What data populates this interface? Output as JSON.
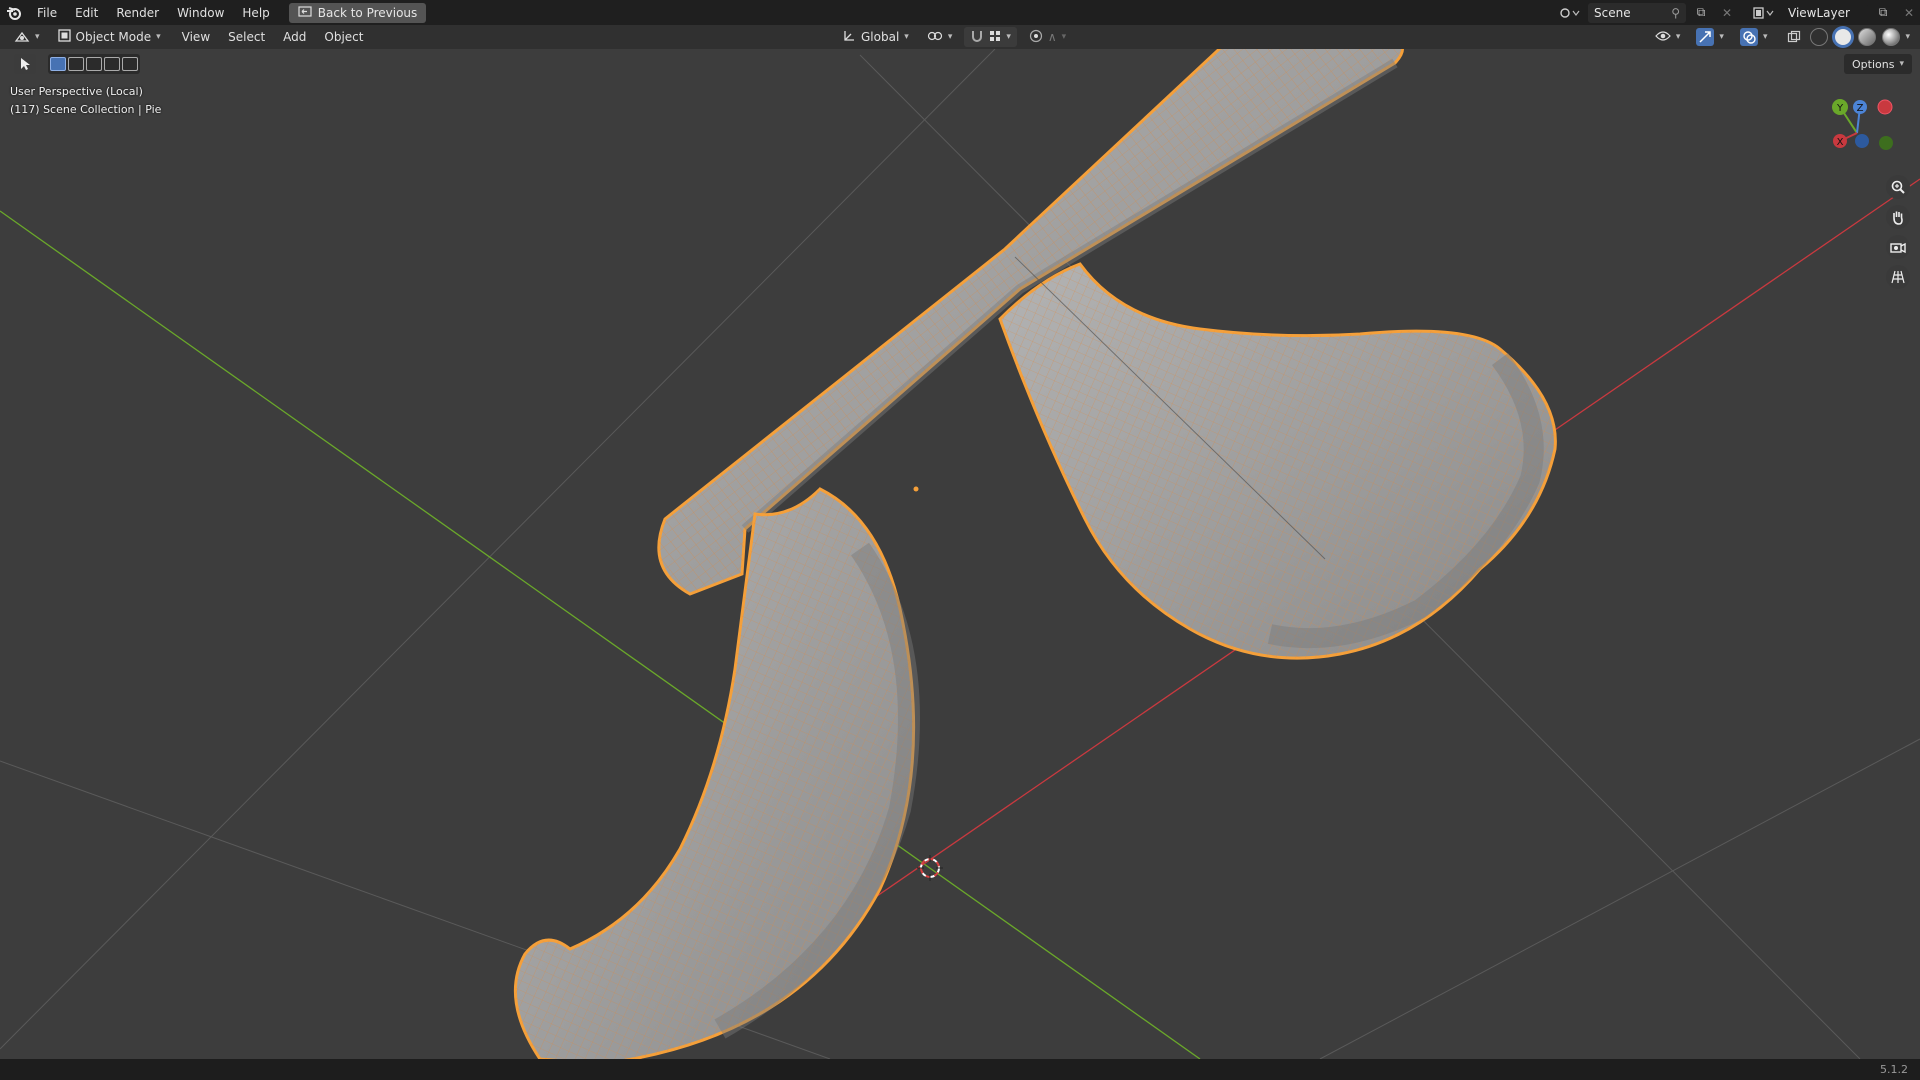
{
  "topbar": {
    "menus": [
      "File",
      "Edit",
      "Render",
      "Window",
      "Help"
    ],
    "back_button": "Back to Previous",
    "scene_name": "Scene",
    "view_layer": "ViewLayer"
  },
  "header": {
    "mode": "Object Mode",
    "menus": [
      "View",
      "Select",
      "Add",
      "Object"
    ],
    "transform_orientation": "Global"
  },
  "viewport": {
    "perspective_label": "User Perspective (Local)",
    "collection_label": "(117) Scene Collection | Pie",
    "options_label": "Options",
    "gizmo": {
      "y": "Y",
      "z": "Z",
      "x": "X"
    }
  },
  "status": {
    "version": "5.1.2"
  },
  "colors": {
    "selection_outline": "#f5a03a",
    "mesh_fill": "#9e9e9e",
    "x_axis": "#c9393f",
    "y_axis": "#6aa82a",
    "accent": "#4772b3"
  }
}
